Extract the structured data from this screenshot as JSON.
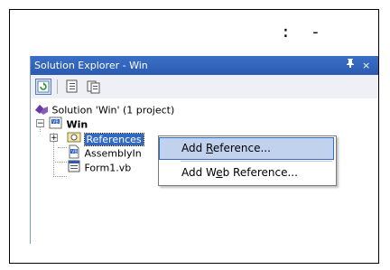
{
  "top_marks": {
    "colon": ":",
    "dash": "-"
  },
  "solution_explorer": {
    "title": "Solution Explorer - Win",
    "pin_glyph": "❤",
    "close_glyph": "×",
    "toolbar": [
      {
        "icon": "refresh-icon"
      },
      {
        "icon": "properties-icon"
      },
      {
        "icon": "show-all-files-icon"
      }
    ],
    "tree": {
      "solution": "Solution 'Win' (1 project)",
      "project": "Win",
      "references": "References",
      "assembly": "AssemblyIn",
      "form": "Form1.vb"
    }
  },
  "context_menu": {
    "add_reference": {
      "before": "Add ",
      "accel": "R",
      "after": "eference..."
    },
    "add_web_reference": {
      "before": "Add W",
      "accel": "e",
      "after": "b Reference..."
    }
  },
  "colors": {
    "title_bar": "#2a5ab2",
    "selection": "#316ac5",
    "menu_highlight": "#c1d2ee"
  }
}
